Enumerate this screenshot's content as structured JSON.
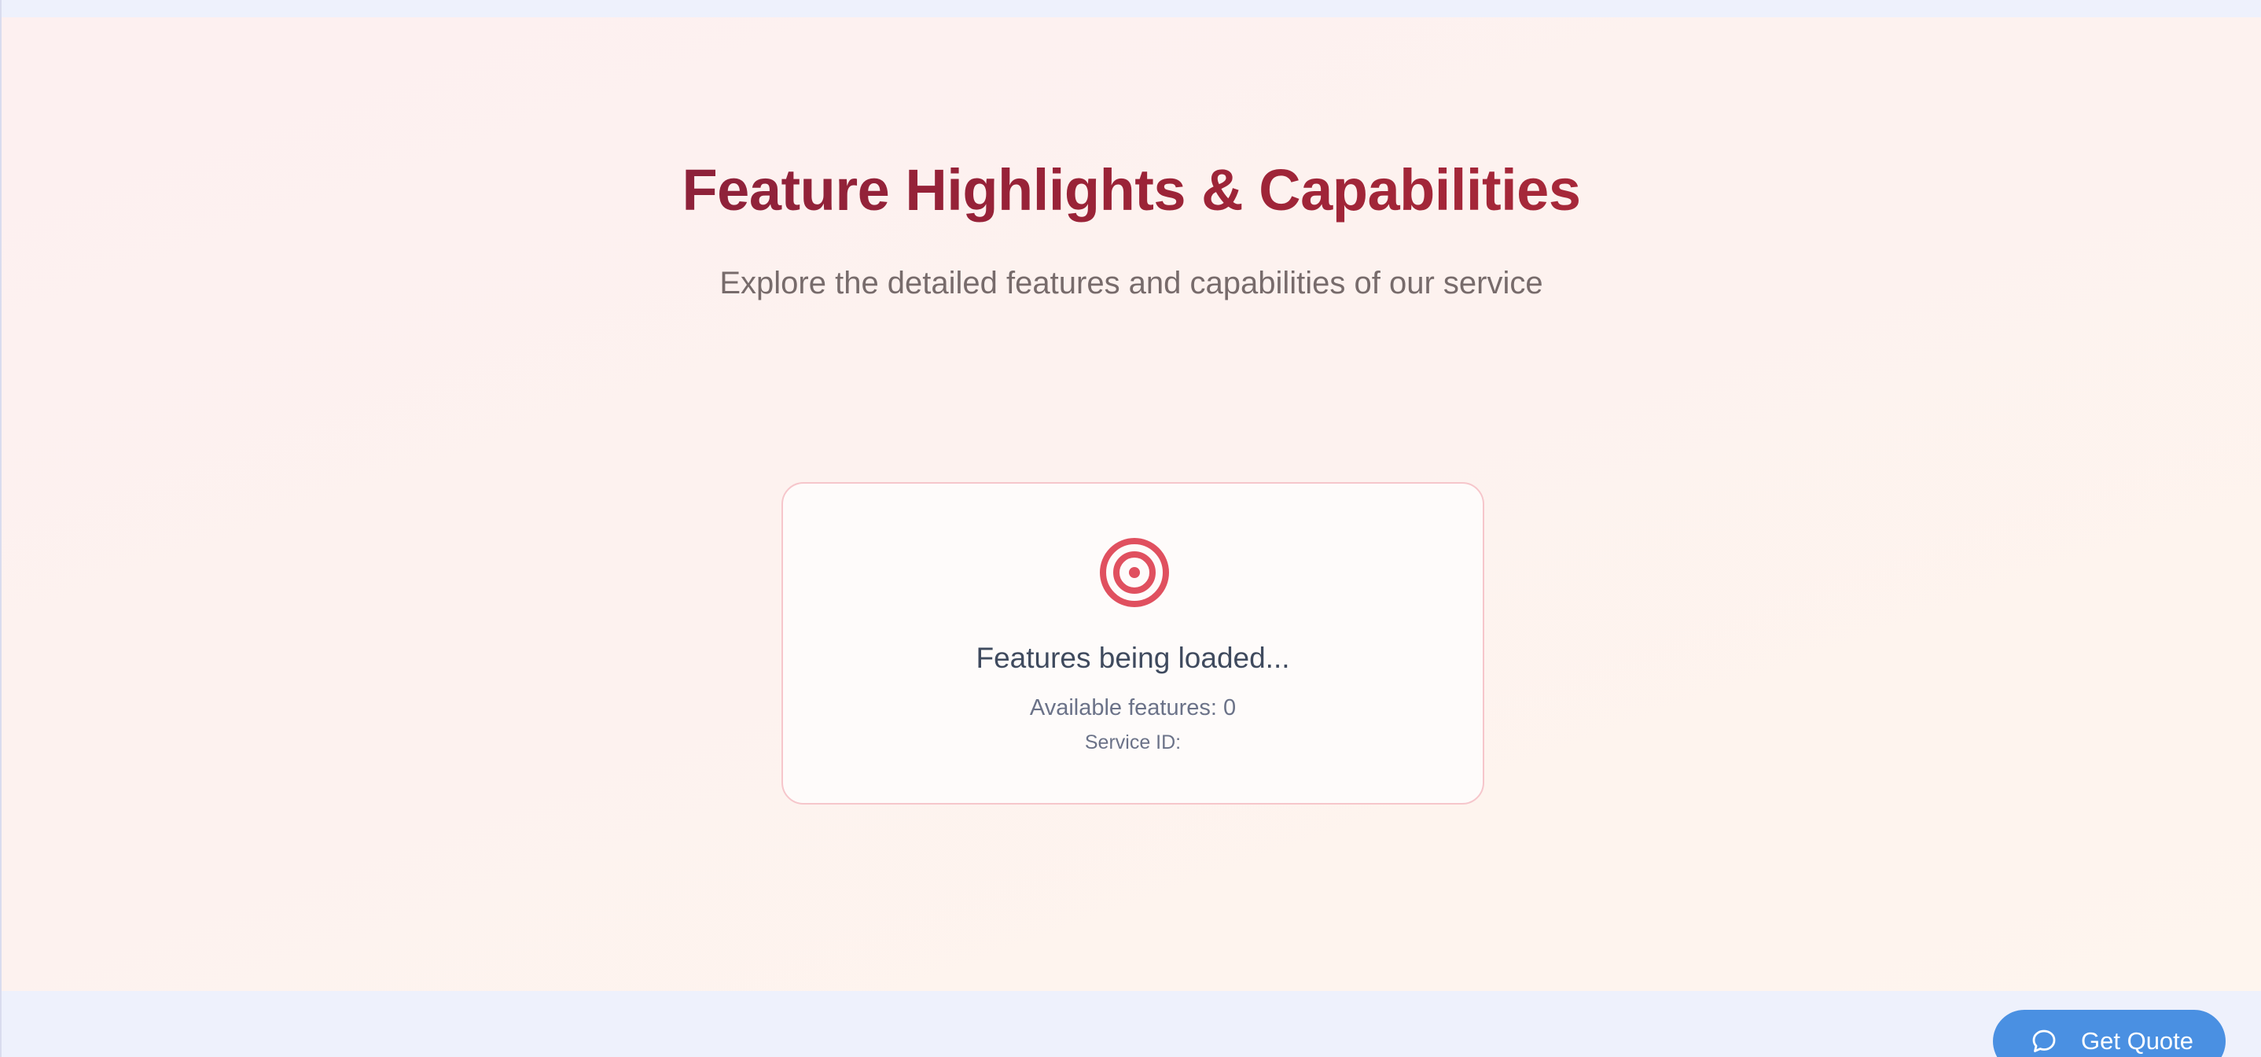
{
  "hero": {
    "title": "Feature Highlights & Capabilities",
    "subtitle": "Explore the detailed features and capabilities of our service"
  },
  "card": {
    "icon": "target-icon",
    "status": "Features being loaded...",
    "available_features": "Available features: 0",
    "service_id": "Service ID:"
  },
  "quote_button": {
    "icon": "chat-bubble-icon",
    "label": "Get Quote"
  },
  "colors": {
    "title_gradient_start": "#7a1f3f",
    "title_gradient_end": "#b8303d",
    "icon_red": "#e0505f",
    "button_blue": "#4a90e2"
  }
}
